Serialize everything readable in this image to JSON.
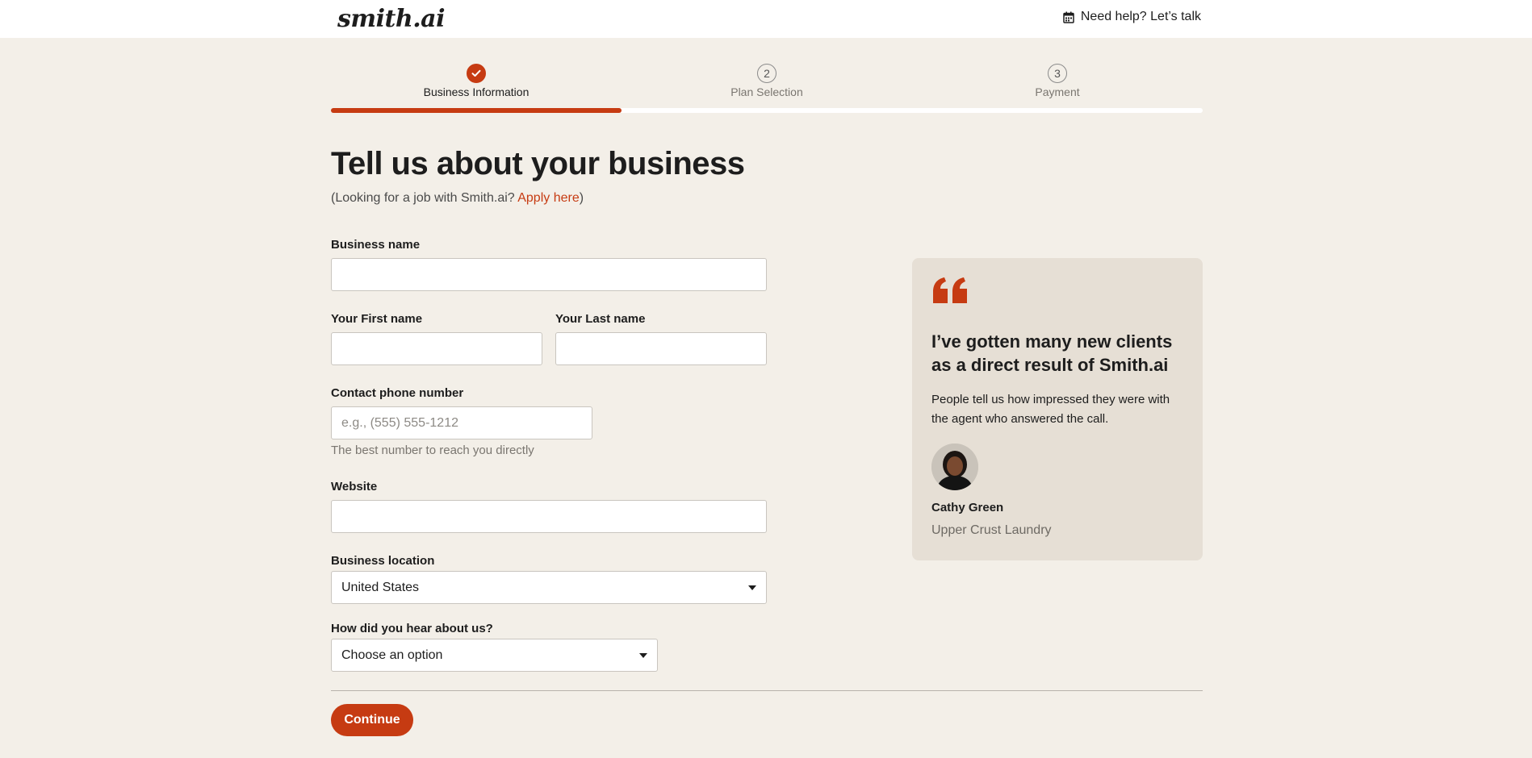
{
  "header": {
    "logo_text": "smith.ai",
    "help_label": "Need help? Let’s talk",
    "help_icon": "calendar-icon"
  },
  "stepper": {
    "steps": [
      {
        "number": "1",
        "label": "Business Information",
        "state": "completed",
        "icon": "check-icon"
      },
      {
        "number": "2",
        "label": "Plan Selection",
        "state": "upcoming"
      },
      {
        "number": "3",
        "label": "Payment",
        "state": "upcoming"
      }
    ],
    "progress_fraction": 0.3333,
    "accent_color": "#c63b12"
  },
  "main": {
    "title": "Tell us about your business",
    "subtitle_prefix": "(Looking for a job with Smith.ai? ",
    "subtitle_link": "Apply here",
    "subtitle_suffix": ")"
  },
  "form": {
    "business_name_label": "Business name",
    "business_name_value": "",
    "first_name_label": "Your First name",
    "first_name_value": "",
    "last_name_label": "Your Last name",
    "last_name_value": "",
    "phone_label": "Contact phone number",
    "phone_placeholder": "e.g., (555) 555-1212",
    "phone_value": "",
    "phone_hint": "The best number to reach you directly",
    "website_label": "Website",
    "website_value": "",
    "location_label": "Business location",
    "location_value": "United States",
    "referral_label": "How did you hear about us?",
    "referral_value": "Choose an option",
    "continue_label": "Continue"
  },
  "testimonial": {
    "quote": "I’ve gotten many new clients as a direct result of Smith.ai",
    "body": "People tell us how impressed they were with the agent who answered the call.",
    "name": "Cathy Green",
    "company": "Upper Crust Laundry",
    "quote_icon": "quote-icon"
  },
  "colors": {
    "page_background": "#f3efe8",
    "card_background": "#e6dfd5",
    "brand_orange": "#c63b12"
  }
}
